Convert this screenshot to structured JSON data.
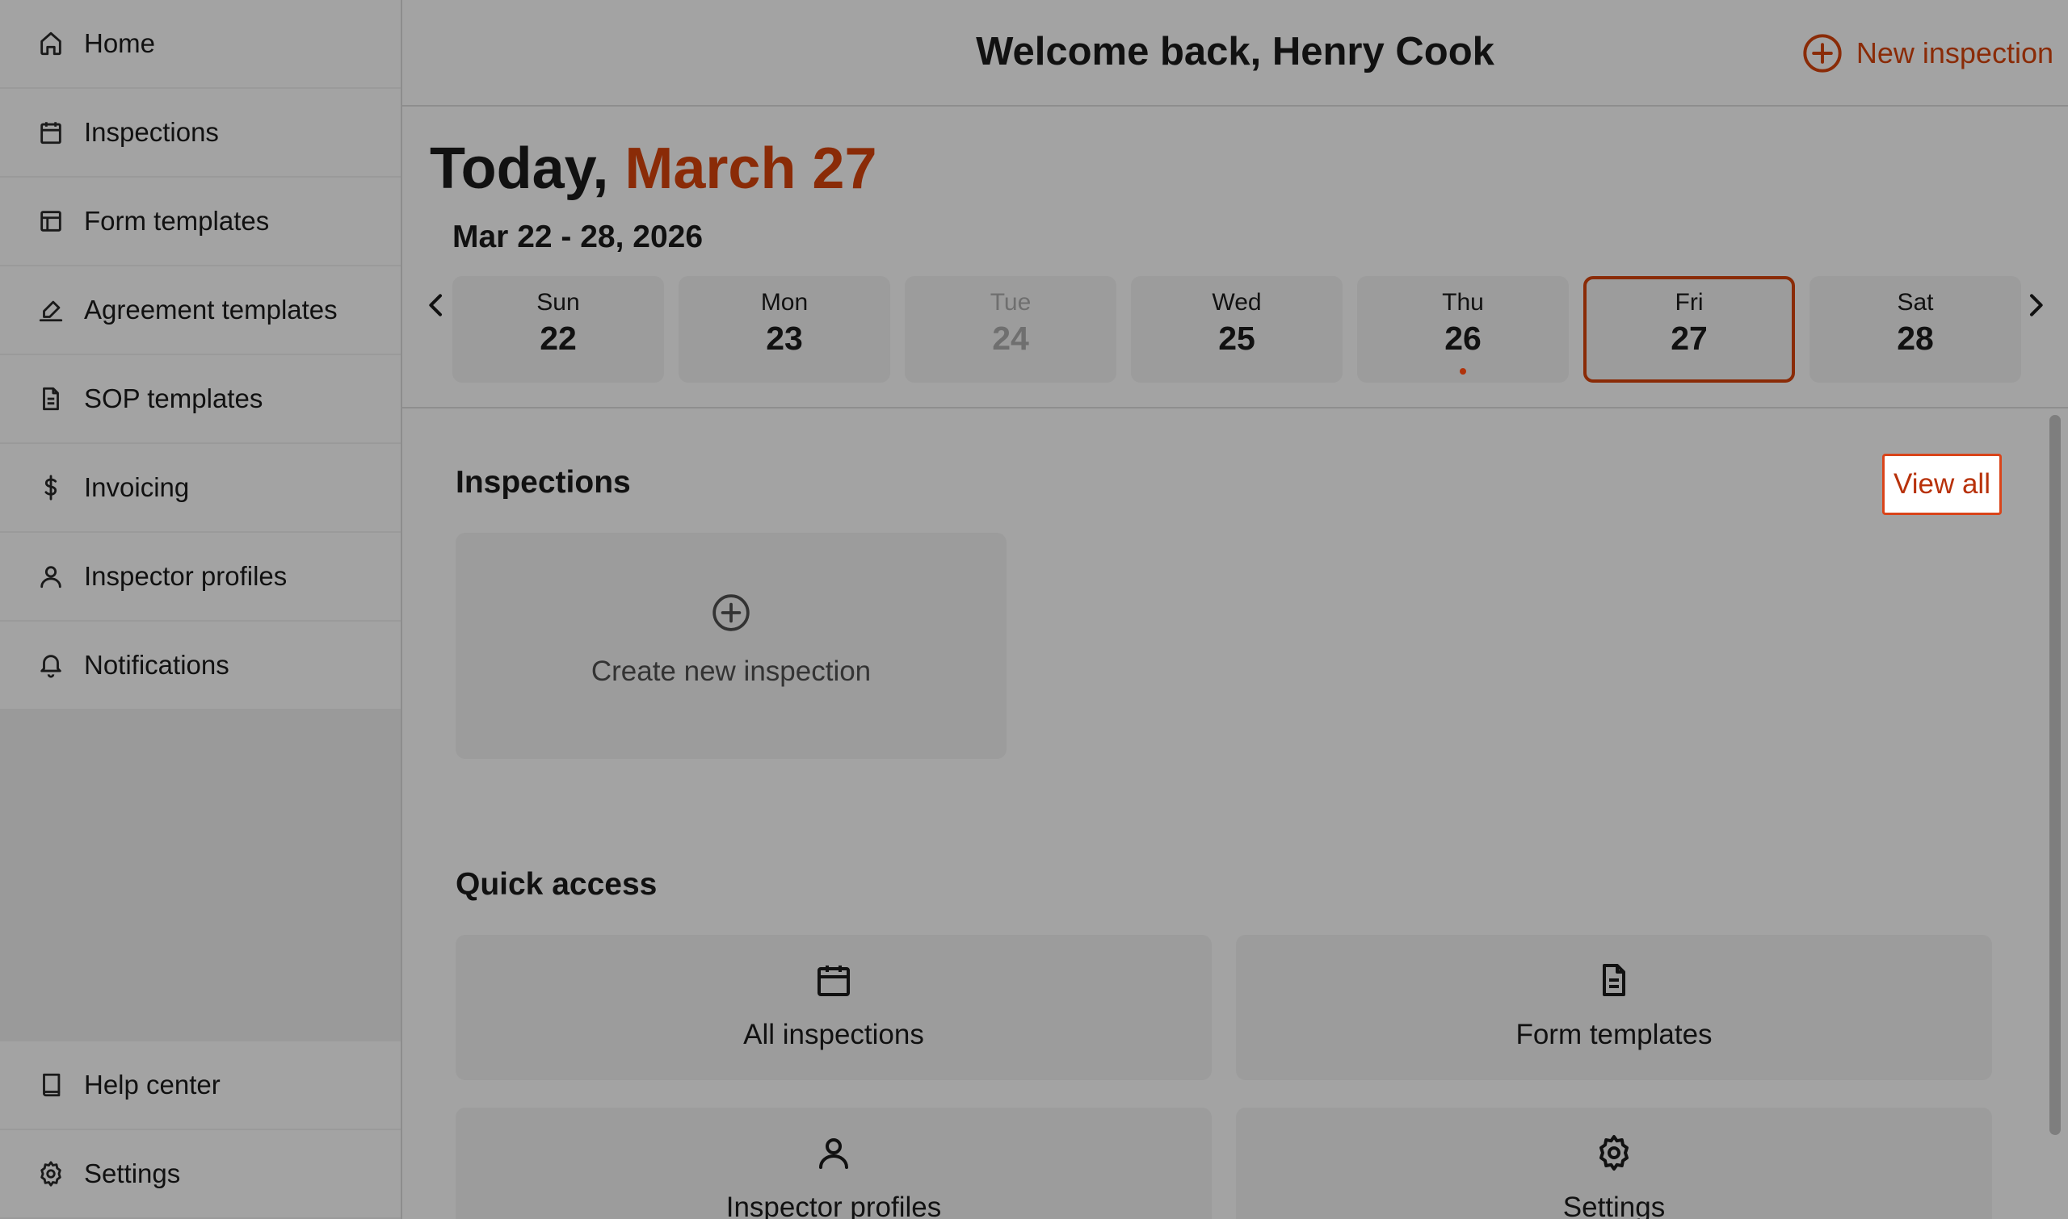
{
  "sidebar": {
    "items": [
      {
        "label": "Home",
        "icon": "home-icon"
      },
      {
        "label": "Inspections",
        "icon": "calendar-icon"
      },
      {
        "label": "Form templates",
        "icon": "layout-icon"
      },
      {
        "label": "Agreement templates",
        "icon": "signature-icon"
      },
      {
        "label": "SOP templates",
        "icon": "document-icon"
      },
      {
        "label": "Invoicing",
        "icon": "dollar-icon"
      },
      {
        "label": "Inspector profiles",
        "icon": "user-icon"
      },
      {
        "label": "Notifications",
        "icon": "bell-icon"
      }
    ],
    "bottom_items": [
      {
        "label": "Help center",
        "icon": "book-icon"
      },
      {
        "label": "Settings",
        "icon": "gear-icon"
      }
    ]
  },
  "header": {
    "title": "Welcome back, Henry Cook",
    "new_inspection_label": "New inspection"
  },
  "date_section": {
    "today_prefix": "Today,",
    "today_date": "March 27",
    "range": "Mar 22 - 28, 2026",
    "days": [
      {
        "name": "Sun",
        "num": "22"
      },
      {
        "name": "Mon",
        "num": "23"
      },
      {
        "name": "Tue",
        "num": "24",
        "muted": true
      },
      {
        "name": "Wed",
        "num": "25"
      },
      {
        "name": "Thu",
        "num": "26",
        "has_event": true
      },
      {
        "name": "Fri",
        "num": "27",
        "selected": true
      },
      {
        "name": "Sat",
        "num": "28"
      }
    ]
  },
  "inspections": {
    "title": "Inspections",
    "view_all_label": "View all",
    "create_label": "Create new inspection"
  },
  "quick_access": {
    "title": "Quick access",
    "items": [
      {
        "label": "All inspections",
        "icon": "calendar-icon"
      },
      {
        "label": "Form templates",
        "icon": "document-icon"
      },
      {
        "label": "Inspector profiles",
        "icon": "user-icon"
      },
      {
        "label": "Settings",
        "icon": "gear-icon"
      }
    ]
  },
  "colors": {
    "accent": "#8a2b07",
    "view_all_border": "#d9441a",
    "overlay_bg": "#a3a3a3"
  }
}
